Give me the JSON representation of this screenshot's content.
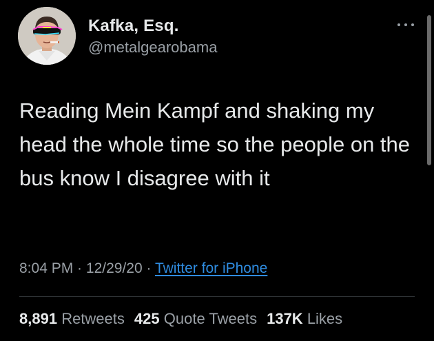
{
  "author": {
    "name": "Kafka, Esq.",
    "handle": "@metalgearobama",
    "avatar_icon": "profile-photo-avatar"
  },
  "tweet": {
    "text": "Reading Mein Kampf and shaking my head the whole time so the people on the bus know I disagree with it"
  },
  "meta": {
    "time": "8:04 PM",
    "separator": " · ",
    "date": "12/29/20",
    "source": "Twitter for iPhone"
  },
  "stats": {
    "retweets_count": "8,891",
    "retweets_label": "Retweets",
    "quotes_count": "425",
    "quotes_label": "Quote Tweets",
    "likes_count": "137K",
    "likes_label": "Likes"
  },
  "colors": {
    "background": "#000000",
    "primary_text": "#e7e9ea",
    "secondary_text": "#9aa0a6",
    "link": "#2f8ce0",
    "divider": "#2f3336"
  },
  "icons": {
    "more": "more-horizontal-icon"
  }
}
